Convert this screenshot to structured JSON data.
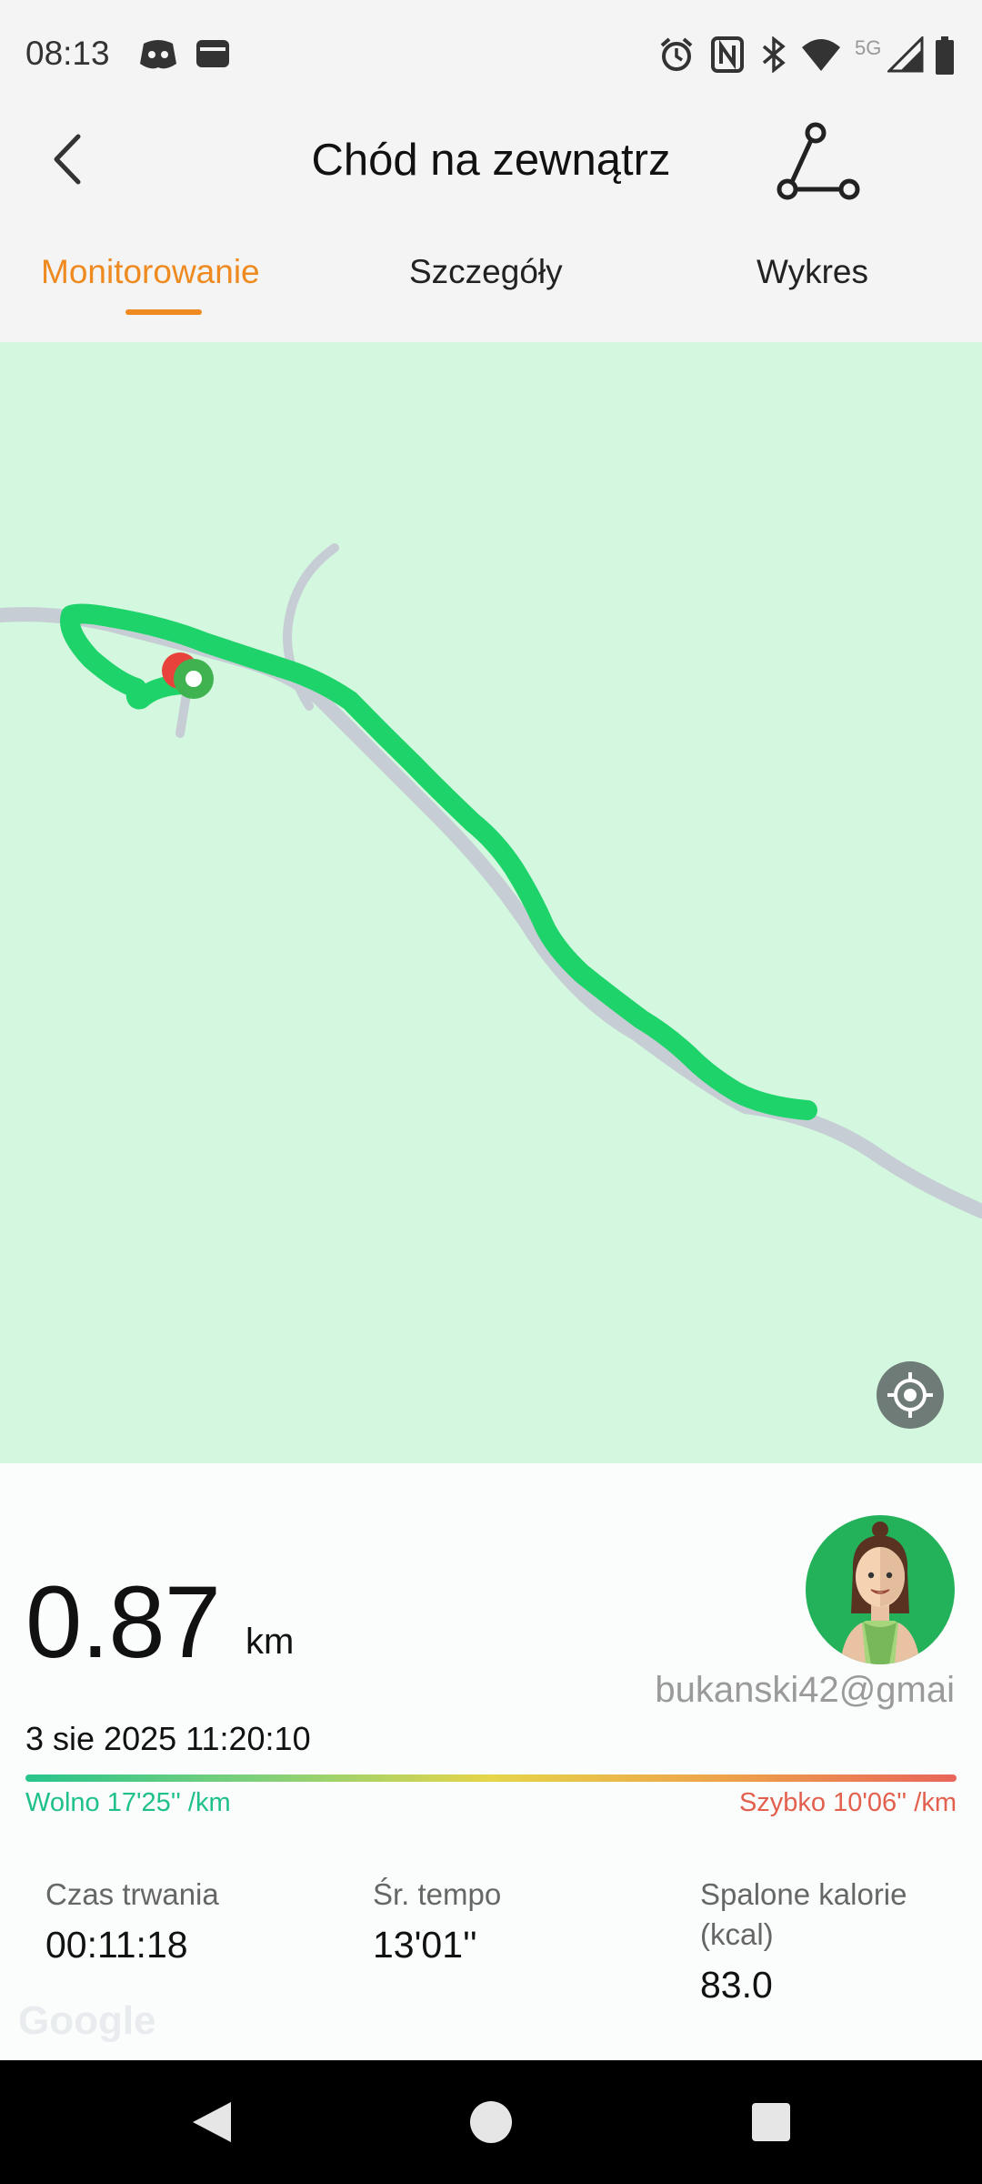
{
  "status_bar": {
    "time": "08:13",
    "icons": [
      "discord-icon",
      "wallet-icon",
      "alarm-icon",
      "nfc-icon",
      "bluetooth-icon",
      "wifi-icon",
      "network-5g-icon",
      "signal-icon",
      "battery-icon"
    ],
    "network_label": "5G"
  },
  "header": {
    "title": "Chód na zewnątrz",
    "back_icon": "back-arrow-icon",
    "route_icon": "route-icon"
  },
  "tabs": [
    {
      "label": "Monitorowanie",
      "active": true
    },
    {
      "label": "Szczegóły",
      "active": false
    },
    {
      "label": "Wykres",
      "active": false
    }
  ],
  "map": {
    "route_color": "#1ed46a",
    "road_color": "#c6cdd4",
    "background": "#d3f7df",
    "start_marker_color": "#e8433a",
    "end_marker_color": "#3fb34f"
  },
  "summary": {
    "distance": "0.87",
    "distance_unit": "km",
    "username": "bukanski42@gmai",
    "datetime": "3 sie 2025 11:20:10",
    "slow_label": "Wolno 17'25'' /km",
    "fast_label": "Szybko 10'06'' /km"
  },
  "stats": [
    {
      "label": "Czas trwania",
      "value": "00:11:18"
    },
    {
      "label": "Śr. tempo",
      "value": "13'01''"
    },
    {
      "label": "Spalone kalorie (kcal)",
      "value": "83.0"
    }
  ],
  "watermark": "Google",
  "accent_color": "#ee8a1f"
}
